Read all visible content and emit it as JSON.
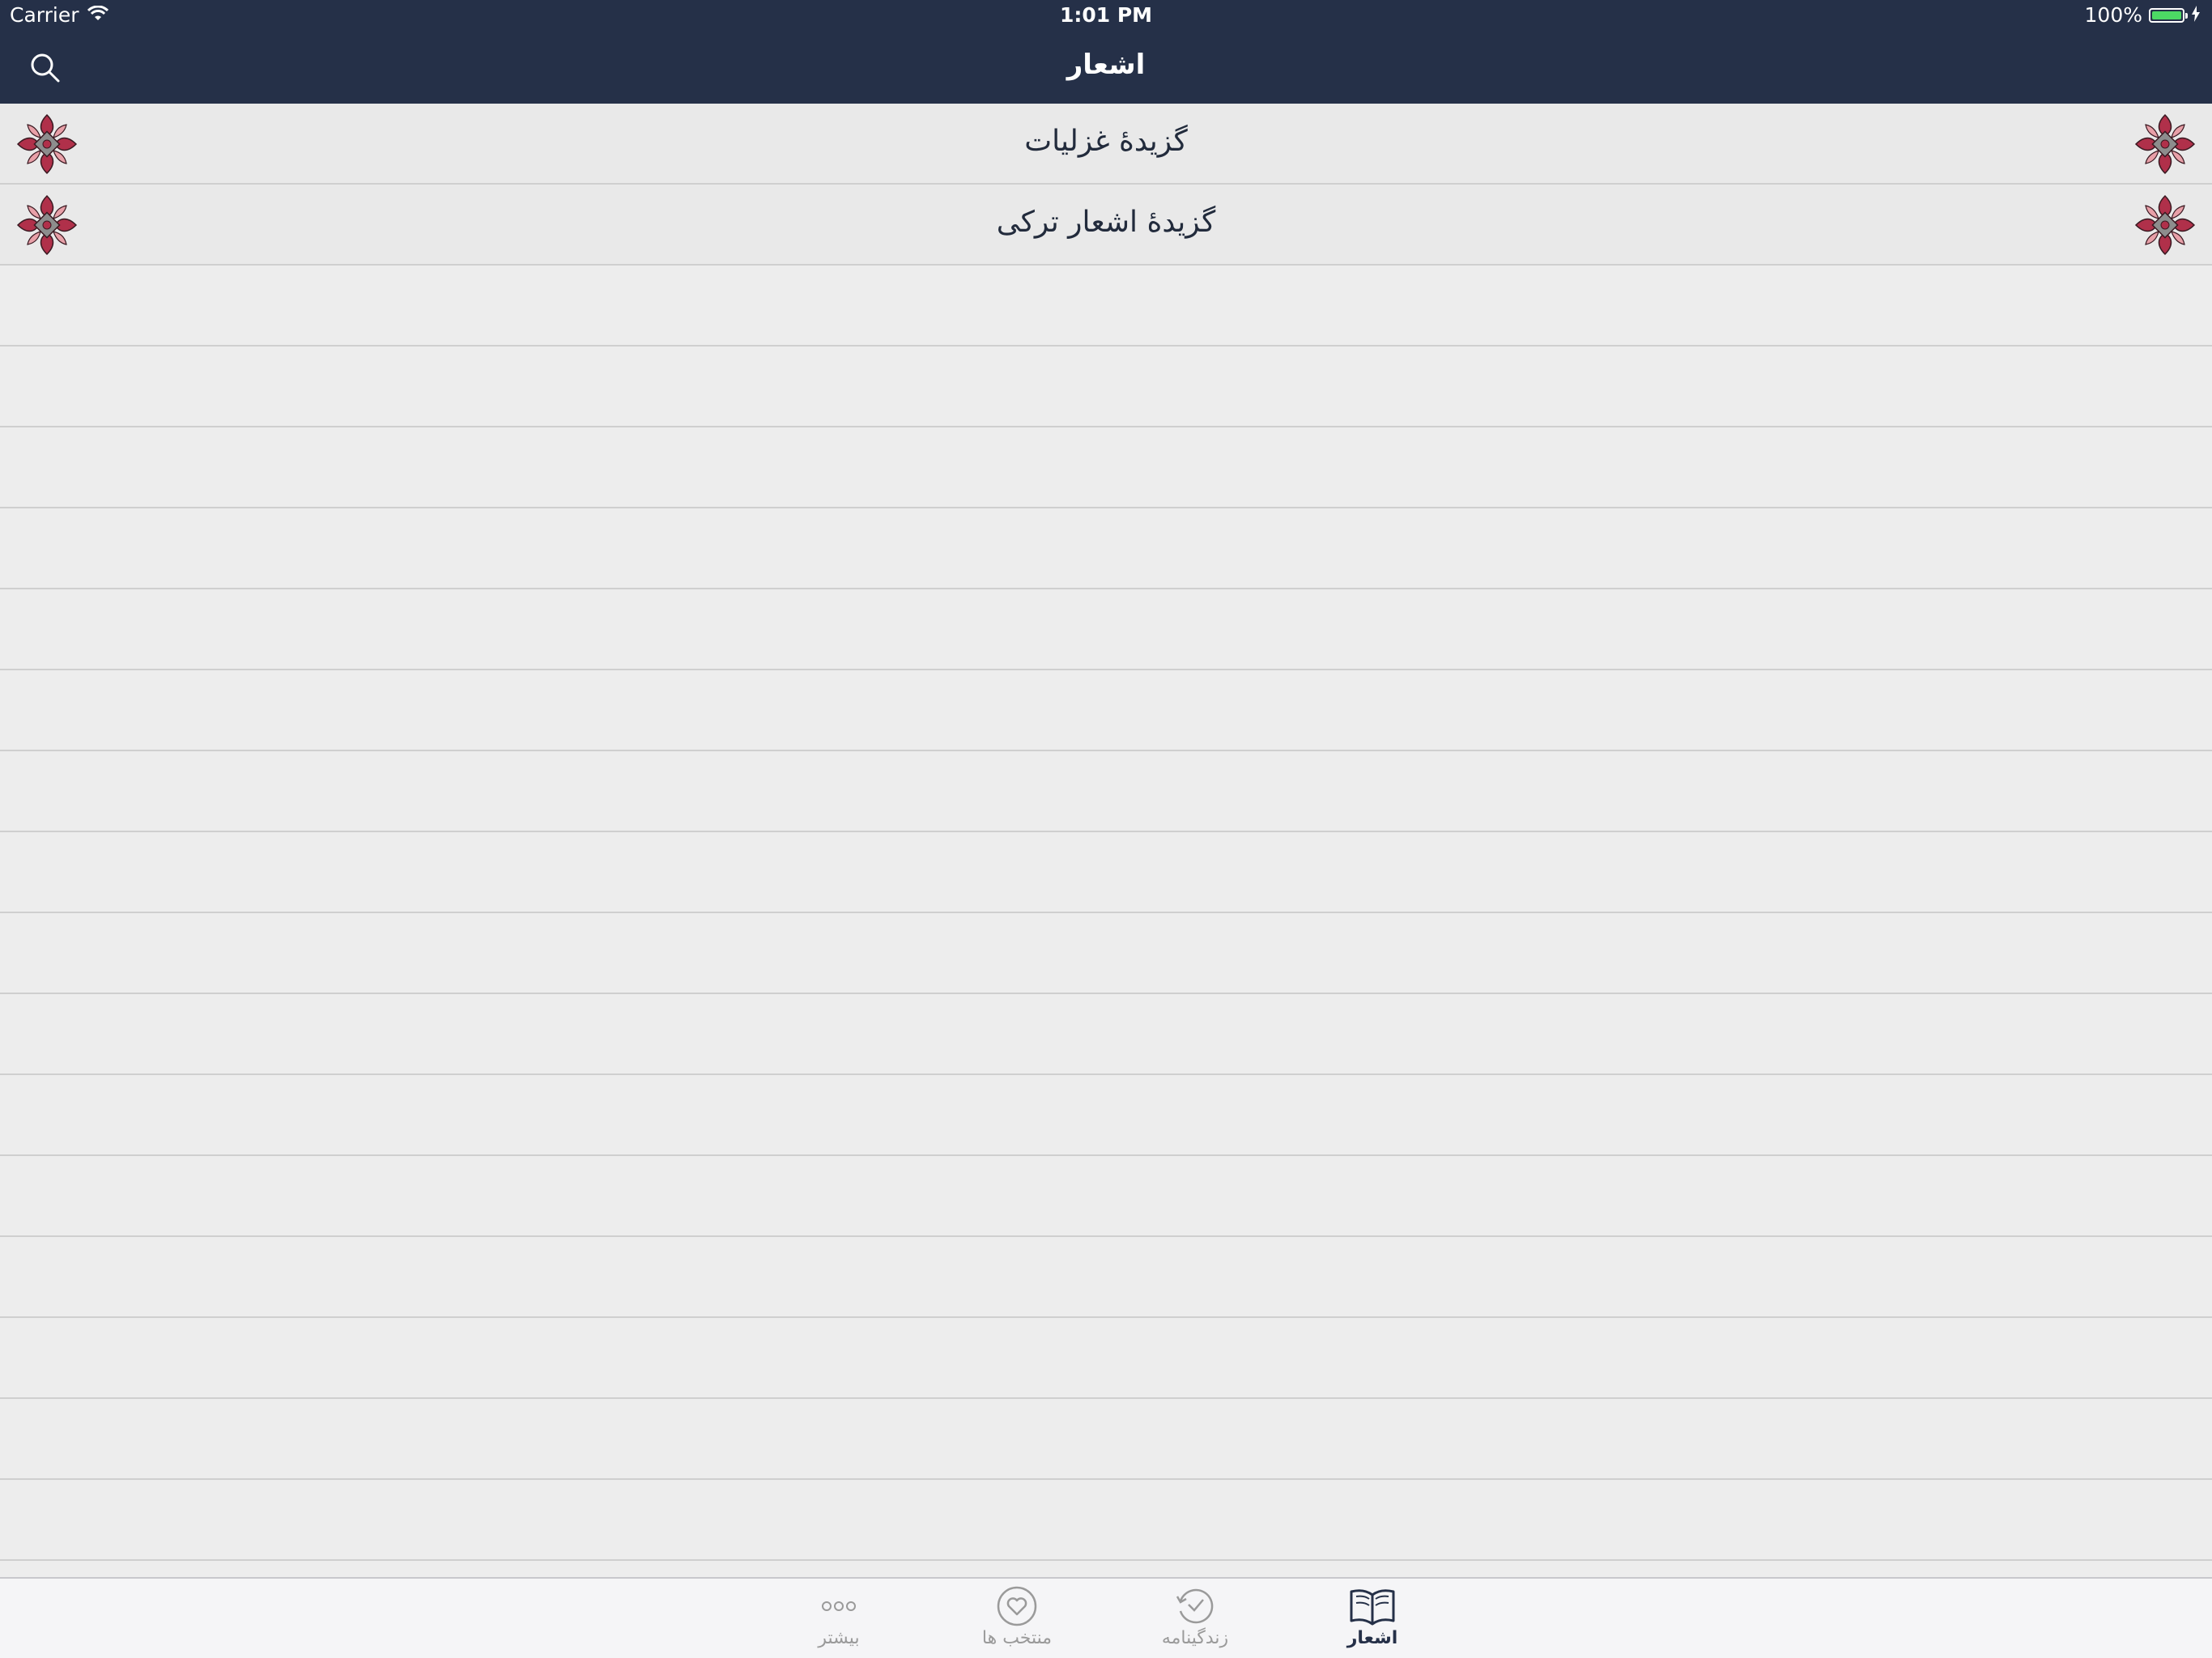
{
  "status_bar": {
    "carrier": "Carrier",
    "time": "1:01 PM",
    "battery": "100%",
    "battery_level": 1.0,
    "battery_color": "#4cd964"
  },
  "nav": {
    "title": "اشعار",
    "search_icon": "search-icon",
    "background": "#253048"
  },
  "list": {
    "items": [
      {
        "label": "گزیدهٔ غزلیات",
        "icon": "floral-ornament-icon"
      },
      {
        "label": "گزیدهٔ اشعار ترکی",
        "icon": "floral-ornament-icon"
      }
    ],
    "empty_rows": 16
  },
  "tab_bar": {
    "tabs": [
      {
        "label": "بیشتر",
        "icon": "more-dots-icon",
        "active": false
      },
      {
        "label": "منتخب ها",
        "icon": "heart-circle-icon",
        "active": false
      },
      {
        "label": "زندگینامه",
        "icon": "history-icon",
        "active": false
      },
      {
        "label": "اشعار",
        "icon": "open-book-icon",
        "active": true
      }
    ],
    "active_color": "#253048",
    "inactive_color": "#9a9a9a"
  }
}
